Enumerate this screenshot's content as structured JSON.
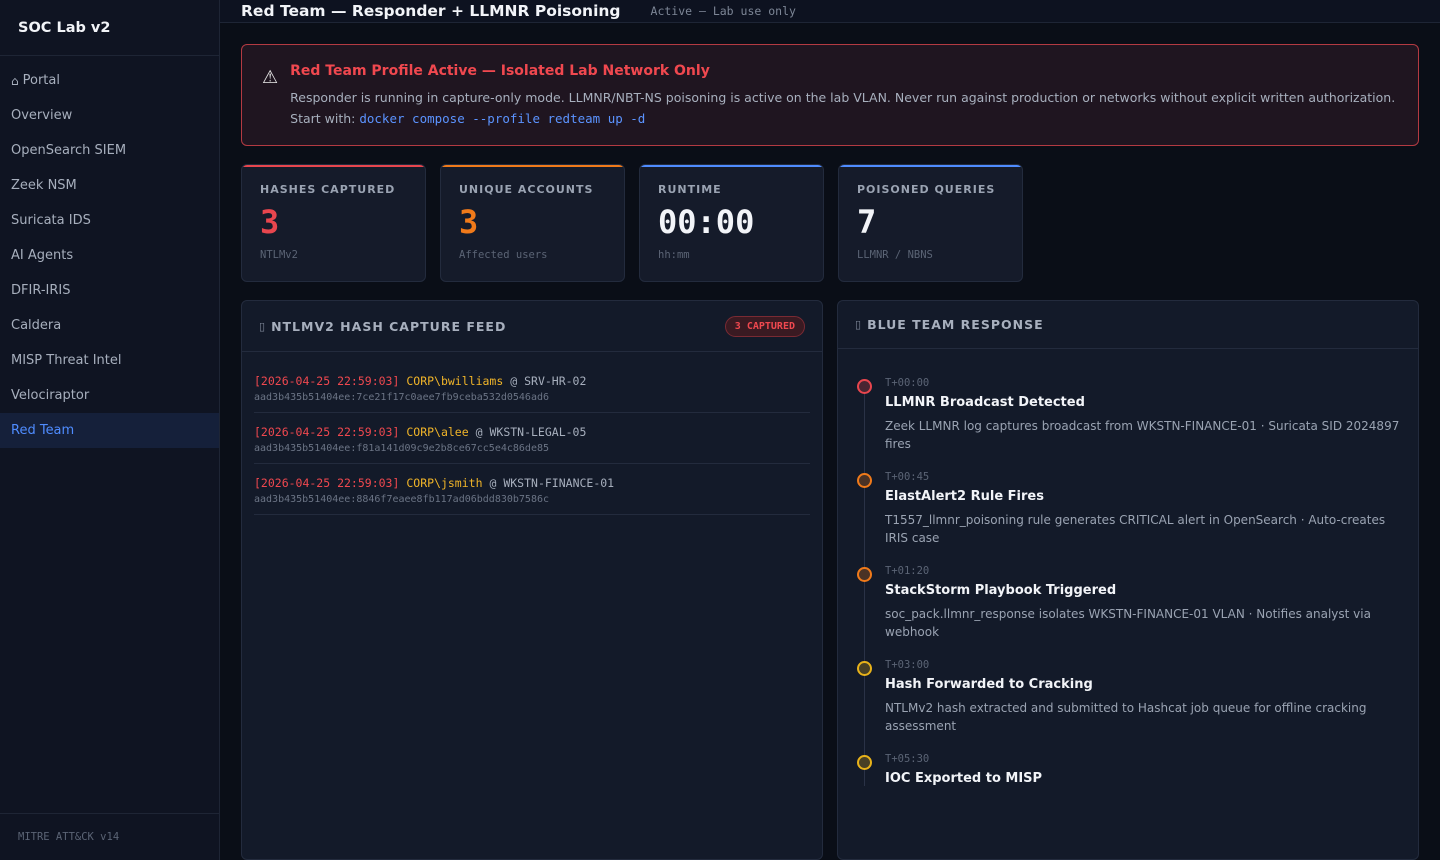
{
  "sidebar": {
    "brand": "SOC Lab v2",
    "items": [
      {
        "label": "Portal",
        "icon": "home-icon"
      },
      {
        "label": "Overview"
      },
      {
        "label": "OpenSearch SIEM"
      },
      {
        "label": "Zeek NSM"
      },
      {
        "label": "Suricata IDS"
      },
      {
        "label": "AI Agents"
      },
      {
        "label": "DFIR-IRIS"
      },
      {
        "label": "Caldera"
      },
      {
        "label": "MISP Threat Intel"
      },
      {
        "label": "Velociraptor"
      },
      {
        "label": "Red Team",
        "active": true
      }
    ],
    "footer": "MITRE ATT&CK v14"
  },
  "header": {
    "title": "Red Team — Responder + LLMNR Poisoning",
    "status": "Active — Lab use only"
  },
  "alert": {
    "icon": "warning-icon",
    "title": "Red Team Profile Active — Isolated Lab Network Only",
    "text": "Responder is running in capture-only mode. LLMNR/NBT-NS poisoning is active on the lab VLAN. Never run against production or networks without explicit written authorization. Start with: ",
    "command": "docker compose --profile redteam up -d"
  },
  "stats": [
    {
      "label": "HASHES CAPTURED",
      "value": "3",
      "sub": "NTLMv2",
      "color": "#e8464e"
    },
    {
      "label": "UNIQUE ACCOUNTS",
      "value": "3",
      "sub": "Affected users",
      "color": "#f07a1a"
    },
    {
      "label": "RUNTIME",
      "value": "00:00",
      "sub": "hh:mm",
      "color": "#4f8cff"
    },
    {
      "label": "POISONED QUERIES",
      "value": "7",
      "sub": "LLMNR / NBNS",
      "color": "#4f8cff"
    }
  ],
  "feed": {
    "title": "NTLMV2 HASH CAPTURE FEED",
    "badge": "3 CAPTURED",
    "rows": [
      {
        "ts": "[2026-04-25 22:59:03]",
        "account": "CORP\\bwilliams",
        "at": "@",
        "host": "SRV-HR-02",
        "hash": "aad3b435b51404ee:7ce21f17c0aee7fb9ceba532d0546ad6"
      },
      {
        "ts": "[2026-04-25 22:59:03]",
        "account": "CORP\\alee",
        "at": "@",
        "host": "WKSTN-LEGAL-05",
        "hash": "aad3b435b51404ee:f81a141d09c9e2b8ce67cc5e4c86de85"
      },
      {
        "ts": "[2026-04-25 22:59:03]",
        "account": "CORP\\jsmith",
        "at": "@",
        "host": "WKSTN-FINANCE-01",
        "hash": "aad3b435b51404ee:8846f7eaee8fb117ad06bdd830b7586c"
      }
    ]
  },
  "response": {
    "title": "BLUE TEAM RESPONSE",
    "events": [
      {
        "time": "T+00:00",
        "title": "LLMNR Broadcast Detected",
        "desc": "Zeek LLMNR log captures broadcast from WKSTN-FINANCE-01 · Suricata SID 2024897 fires",
        "color": "#e8464e"
      },
      {
        "time": "T+00:45",
        "title": "ElastAlert2 Rule Fires",
        "desc": "T1557_llmnr_poisoning rule generates CRITICAL alert in OpenSearch · Auto-creates IRIS case",
        "color": "#f07a1a"
      },
      {
        "time": "T+01:20",
        "title": "StackStorm Playbook Triggered",
        "desc": "soc_pack.llmnr_response isolates WKSTN-FINANCE-01 VLAN · Notifies analyst via webhook",
        "color": "#f07a1a"
      },
      {
        "time": "T+03:00",
        "title": "Hash Forwarded to Cracking",
        "desc": "NTLMv2 hash extracted and submitted to Hashcat job queue for offline cracking assessment",
        "color": "#e8b21a"
      },
      {
        "time": "T+05:30",
        "title": "IOC Exported to MISP",
        "desc": "",
        "color": "#e8b21a"
      }
    ]
  }
}
